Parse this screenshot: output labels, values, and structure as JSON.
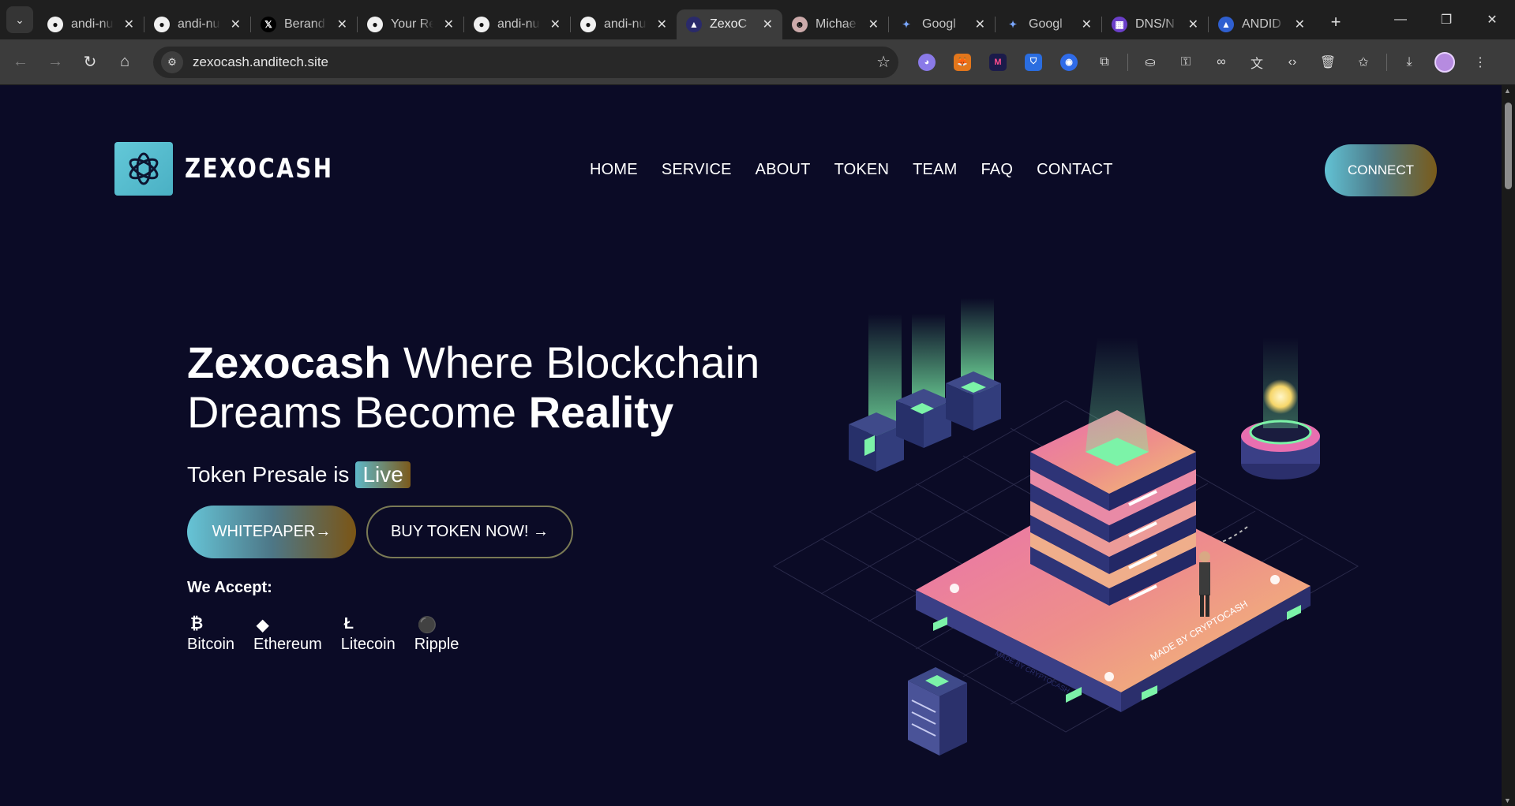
{
  "browser": {
    "tabs": [
      {
        "title": "andi-nu",
        "icon": "github-icon"
      },
      {
        "title": "andi-nu",
        "icon": "github-icon"
      },
      {
        "title": "Berand",
        "icon": "x-icon"
      },
      {
        "title": "Your Re",
        "icon": "github-icon"
      },
      {
        "title": "andi-nu",
        "icon": "github-icon"
      },
      {
        "title": "andi-nu",
        "icon": "github-icon"
      },
      {
        "title": "ZexoC",
        "icon": "zexocash-icon",
        "active": true
      },
      {
        "title": "Michae",
        "icon": "avatar-icon"
      },
      {
        "title": "Googl",
        "icon": "gemini-icon"
      },
      {
        "title": "Googl",
        "icon": "gemini-icon"
      },
      {
        "title": "DNS/N",
        "icon": "dns-icon"
      },
      {
        "title": "ANDID",
        "icon": "andid-icon"
      }
    ],
    "url": "zexocash.anditech.site"
  },
  "site": {
    "logo_text": "ZEXOCASH",
    "nav": [
      "HOME",
      "SERVICE",
      "ABOUT",
      "TOKEN",
      "TEAM",
      "FAQ",
      "CONTACT"
    ],
    "connect_label": "CONNECT",
    "hero": {
      "title_strong_1": "Zexocash",
      "title_mid": " Where Blockchain Dreams Become ",
      "title_strong_2": "Reality",
      "presale_text": "Token Presale is",
      "presale_badge": "Live",
      "whitepaper_label": "WHITEPAPER→",
      "buy_label": "BUY TOKEN NOW! →",
      "accept_label": "We Accept:",
      "coins": [
        {
          "symbol": "₿",
          "name": "Bitcoin"
        },
        {
          "symbol": "◆",
          "name": "Ethereum"
        },
        {
          "symbol": "Ł",
          "name": "Litecoin"
        },
        {
          "symbol": "⚫",
          "name": "Ripple"
        }
      ],
      "art_labels": [
        "MADE BY CRYPTOCASH",
        "MADE BY CRYPTOCASH"
      ]
    }
  },
  "colors": {
    "page_bg": "#0b0b26",
    "accent_teal": "#63c8d8",
    "accent_gold": "#7b5515"
  }
}
